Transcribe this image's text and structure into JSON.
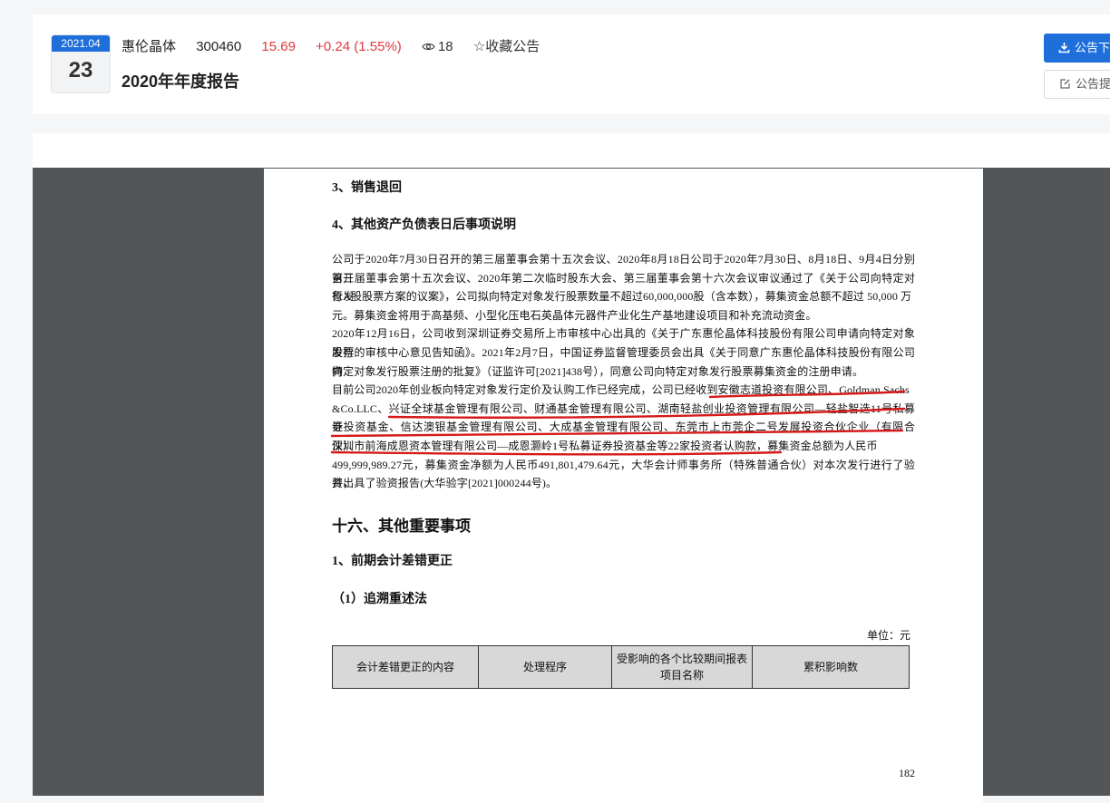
{
  "header": {
    "date_ym": "2021.04",
    "date_day": "23",
    "company": "惠伦晶体",
    "code": "300460",
    "price": "15.69",
    "change": "+0.24 (1.55%)",
    "views": "18",
    "favorite_label": "☆收藏公告",
    "title": "2020年年度报告",
    "download_label": "公告下载",
    "tip_label": "公告提醒",
    "colors": {
      "accent": "#1f6fdb",
      "up": "#e0383e"
    }
  },
  "doc": {
    "s3_title": "3、销售退回",
    "s4_title": "4、其他资产负债表日后事项说明",
    "lines": [
      "公司于2020年7月30日召开的第三届董事会第十五次会议、2020年8月18日公司于2020年7月30日、8月18日、9月4日分别召开",
      "第三届董事会第十五次会议、2020年第二次临时股东大会、第三届董事会第十六次会议审议通过了《关于公司向特定对象发",
      "行A股股票方案的议案》，公司拟向特定对象发行股票数量不超过60,000,000股（含本数），募集资金总额不超过 50,000 万",
      "元。募集资金将用于高基频、小型化压电石英晶体元器件产业化生产基地建设项目和补充流动资金。",
      "2020年12月16日，公司收到深圳证券交易所上市审核中心出具的《关于广东惠伦晶体科技股份有限公司申请向特定对象发行",
      "股票的审核中心意见告知函》。2021年2月7日，中国证券监督管理委员会出具《关于同意广东惠伦晶体科技股份有限公司向",
      "特定对象发行股票注册的批复》（证监许可[2021]438号），同意公司向特定对象发行股票募集资金的注册申请。",
      "目前公司2020年创业板向特定对象发行定价及认购工作已经完成，公司已经收到安徽志道投资有限公司、Goldman Sachs",
      "&Co.LLC、兴证全球基金管理有限公司、财通基金管理有限公司、湖南轻盐创业投资管理有限公司—轻盐智选11号私募证",
      "券投资基金、信达澳银基金管理有限公司、大成基金管理有限公司、东莞市上市莞企二号发展投资合伙企业（有限合伙）、",
      "深圳市前海成恩资本管理有限公司—成恩灏岭1号私募证券投资基金等22家投资者认购款，募集资金总额为人民币",
      "499,999,989.27元，募集资金净额为人民币491,801,479.64元，大华会计师事务所（特殊普通合伙）对本次发行进行了验资，",
      "并出具了验资报告(大华验字[2021]000244号)。"
    ],
    "h16_title": "十六、其他重要事项",
    "s1_title": "1、前期会计差错更正",
    "s1a_title": "（1）追溯重述法",
    "unit_label": "单位：元",
    "table_headers": [
      "会计差错更正的内容",
      "处理程序",
      "受影响的各个比较期间报表项目名称",
      "累积影响数"
    ],
    "page_number": "182"
  }
}
